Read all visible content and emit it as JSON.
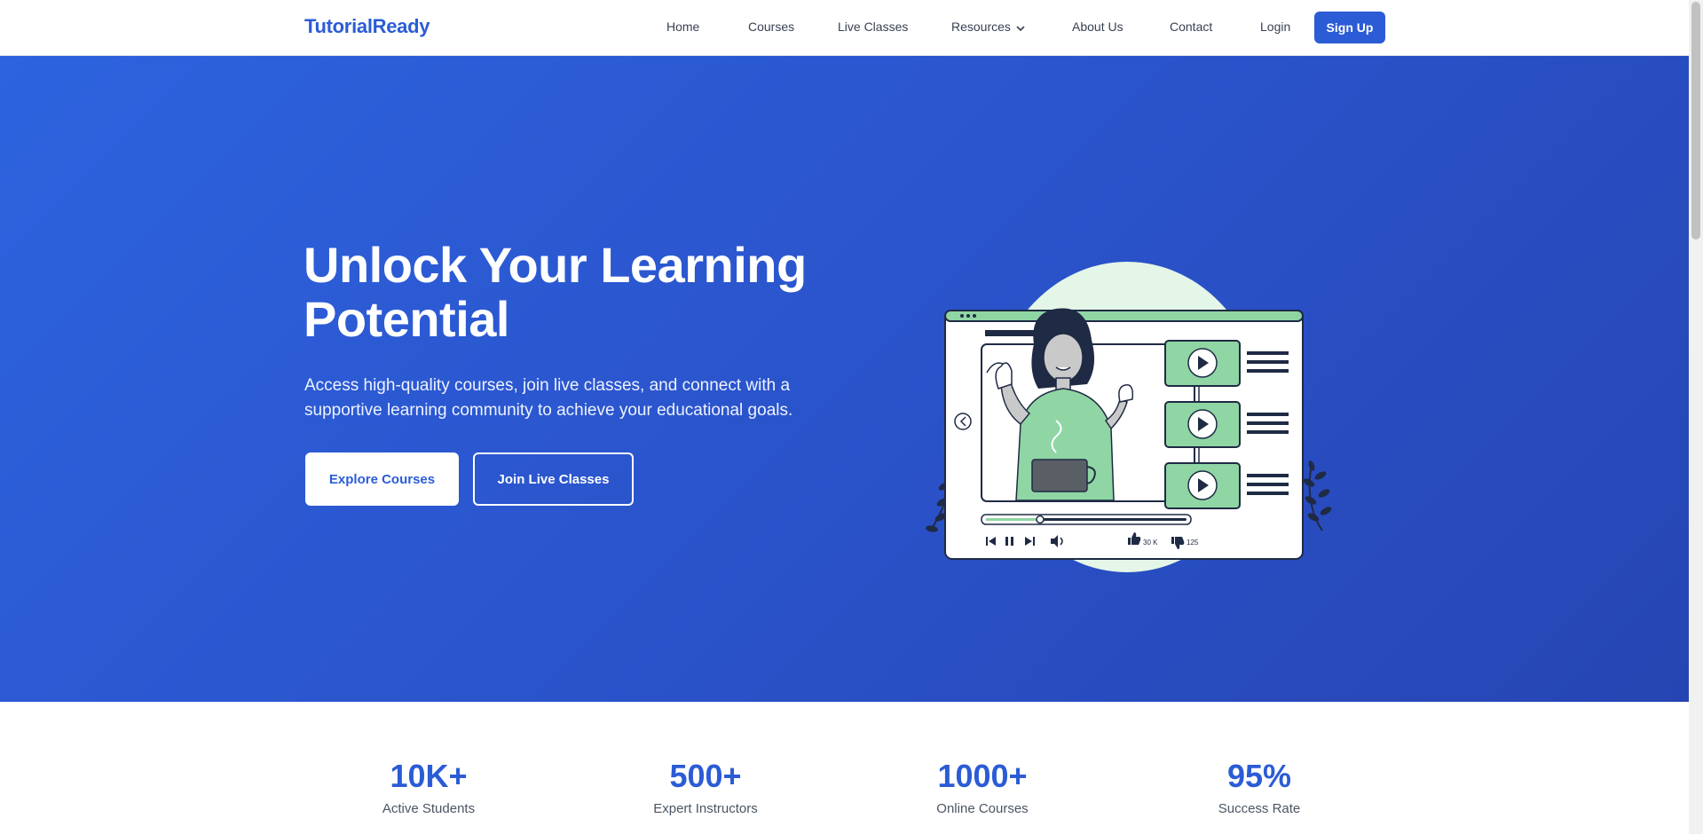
{
  "header": {
    "brand": "TutorialReady",
    "nav": [
      {
        "label": "Home"
      },
      {
        "label": "Courses"
      },
      {
        "label": "Live Classes"
      },
      {
        "label": "Resources"
      },
      {
        "label": "About Us"
      },
      {
        "label": "Contact"
      }
    ],
    "login_label": "Login",
    "signup_label": "Sign Up"
  },
  "hero": {
    "title": "Unlock Your Learning Potential",
    "subtitle": "Access high-quality courses, join live classes, and connect with a supportive learning community to achieve your educational goals.",
    "primary_cta": "Explore Courses",
    "secondary_cta": "Join Live Classes",
    "illustration": {
      "likes": "30 K",
      "dislikes": "125",
      "video_progress": 0.27
    }
  },
  "stats": [
    {
      "value": "10K+",
      "label": "Active Students"
    },
    {
      "value": "500+",
      "label": "Expert Instructors"
    },
    {
      "value": "1000+",
      "label": "Online Courses"
    },
    {
      "value": "95%",
      "label": "Success Rate"
    }
  ],
  "colors": {
    "brand": "#2b5cd6",
    "hero_start": "#2d63df",
    "hero_end": "#2645b3",
    "accent_green": "#8fd6a4",
    "mint": "#e3f6e8"
  },
  "icons": [
    "chevron-down-icon",
    "play-icon",
    "skip-back-icon",
    "pause-icon",
    "skip-forward-icon",
    "volume-icon",
    "thumbs-up-icon",
    "thumbs-down-icon",
    "arrow-left-icon"
  ]
}
